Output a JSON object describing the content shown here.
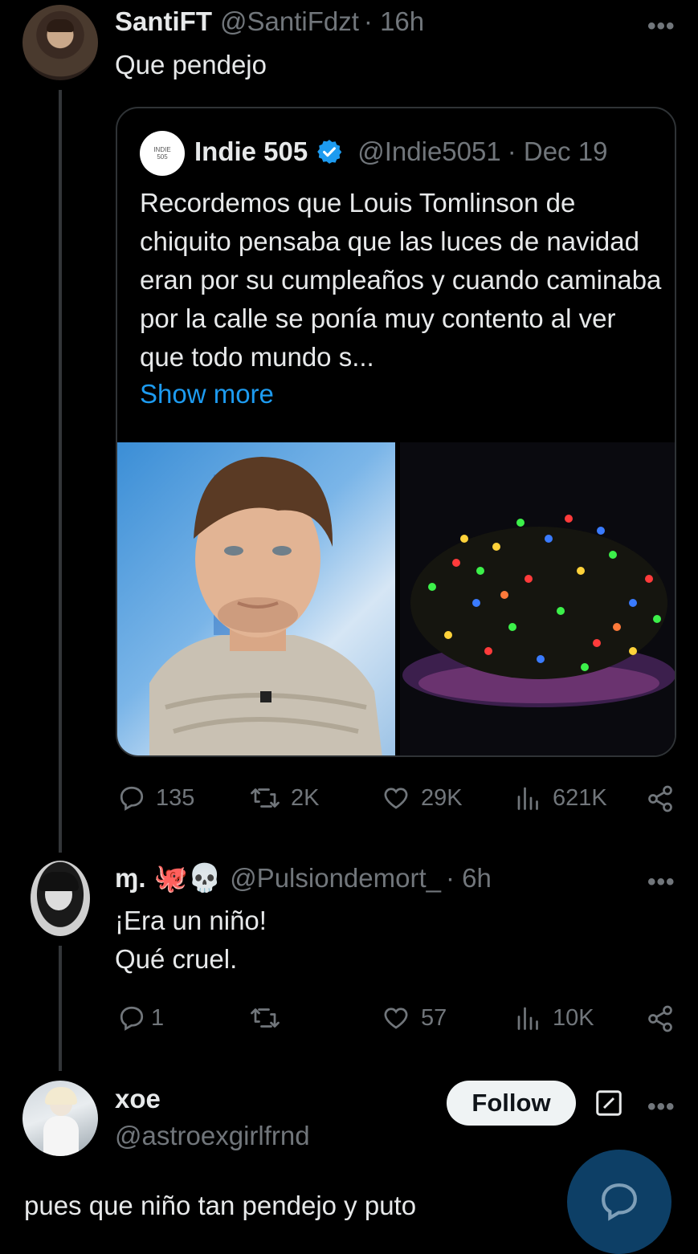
{
  "tweet1": {
    "name": "SantiFT",
    "handle": "@SantiFdzt",
    "time": "· 16h",
    "text": "Que pendejo",
    "quote": {
      "avatar_text": "INDIE 505",
      "name": "Indie 505",
      "handle": "@Indie5051",
      "date": "· Dec 19",
      "text": "Recordemos que Louis Tomlinson de chiquito pensaba que las luces de navidad eran por su cumpleaños y cuando caminaba por la calle se ponía muy contento al ver que todo mundo s...",
      "show_more": "Show more"
    },
    "actions": {
      "replies": "135",
      "retweets": "2K",
      "likes": "29K",
      "views": "621K"
    }
  },
  "tweet2": {
    "name": "ɱ.",
    "emojis": "🐙💀",
    "handle": "@Pulsiondemort_",
    "time": "· 6h",
    "text_line1": "¡Era un niño!",
    "text_line2": "Qué cruel.",
    "actions": {
      "replies": "1",
      "retweets": "",
      "likes": "57",
      "views": "10K"
    }
  },
  "tweet3": {
    "name": "xoe",
    "handle": "@astroexgirlfrnd",
    "follow_label": "Follow",
    "text": "pues que niño tan pendejo y puto"
  },
  "more_glyph": "•••",
  "colors": {
    "background": "#000000",
    "text": "#e7e9ea",
    "muted": "#71767b",
    "link": "#1d9bf0",
    "verified": "#1d9bf0"
  }
}
